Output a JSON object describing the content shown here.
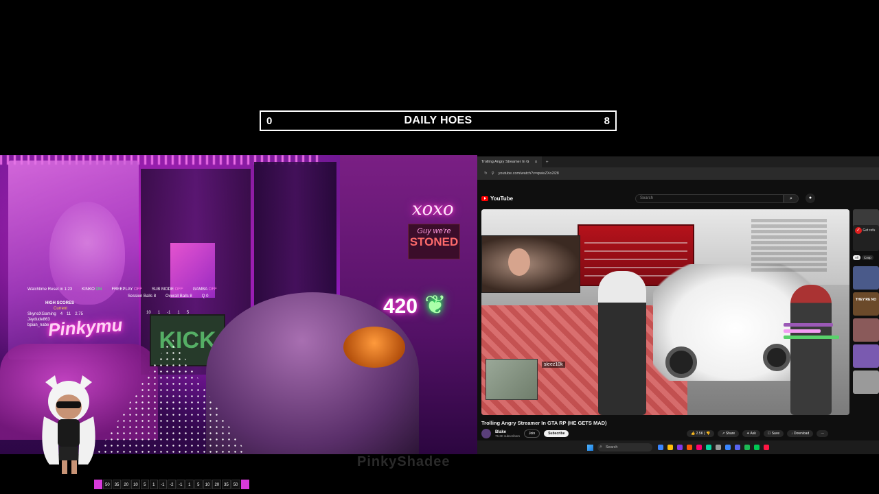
{
  "counter": {
    "left_value": "0",
    "title": "DAILY HOES",
    "right_value": "8"
  },
  "stream_overlay": {
    "watchtime_reset": "Watchtime Reset in 1:23",
    "toggles": [
      {
        "label": "KINKO",
        "state": "ON"
      },
      {
        "label": "FREEPLAY",
        "state": "OFF"
      },
      {
        "label": "SUB MODE",
        "state": "OFF"
      },
      {
        "label": "GAMBA",
        "state": "OFF"
      }
    ],
    "session_balls_label": "Session Balls",
    "session_balls_value": "8",
    "overall_balls_label": "Overall Balls",
    "overall_balls_value": "8",
    "q_label": "Q",
    "q_value": "0",
    "high_scores_title": "HIGH SCORES",
    "high_scores_sub": "Current",
    "high_scores": [
      {
        "name": "SkynoXGaming",
        "a": "4",
        "b": "11",
        "c": "2.75"
      },
      {
        "name": "Jaydude863",
        "a": "",
        "b": "",
        "c": ""
      },
      {
        "name": "bpian_nabe",
        "a": "",
        "b": "",
        "c": ""
      }
    ],
    "mini_values": [
      "10",
      "1",
      "-1",
      "1",
      "5"
    ],
    "score_strip": [
      "50",
      "35",
      "20",
      "10",
      "5",
      "1",
      "-1",
      "-2",
      "-1",
      "1",
      "5",
      "10",
      "20",
      "35",
      "50"
    ],
    "neon_xoxo": "xoxo",
    "neon_stoned_line1": "Guy we're",
    "neon_stoned_line2": "STONED",
    "neon_420": "420",
    "neon_sign": "Pinkymu",
    "kick_screen": "KICK",
    "watermark": "PinkyShadee"
  },
  "browser": {
    "tab_title": "Trolling Angry Streamer In G",
    "url": "youtube.com/watch?v=qwieZXo2l28",
    "youtube_logo": "YouTube",
    "search_placeholder": "Search",
    "video_title": "Trolling Angry Streamer In GTA RP (HE GETS MAD)",
    "channel_name": "Blake",
    "channel_subs": "75.3K subscribers",
    "join_label": "Join",
    "subscribe_label": "Subscribe",
    "like_count": "2.5K",
    "share_label": "Share",
    "ask_label": "Ask",
    "save_label": "Save",
    "download_label": "Download",
    "more_label": "···",
    "ingame_name": "sleez10k",
    "side_card_text": "Get refu",
    "chips": [
      "All",
      "Coop"
    ],
    "side_thumb_text": "THEY'RE NO"
  },
  "taskbar": {
    "search_label": "Search"
  },
  "colors": {
    "neon_pink": "#ff3ccf",
    "neon_green": "#28ff5a",
    "youtube_red": "#ff0000",
    "strip_accent": "#d83adb"
  }
}
